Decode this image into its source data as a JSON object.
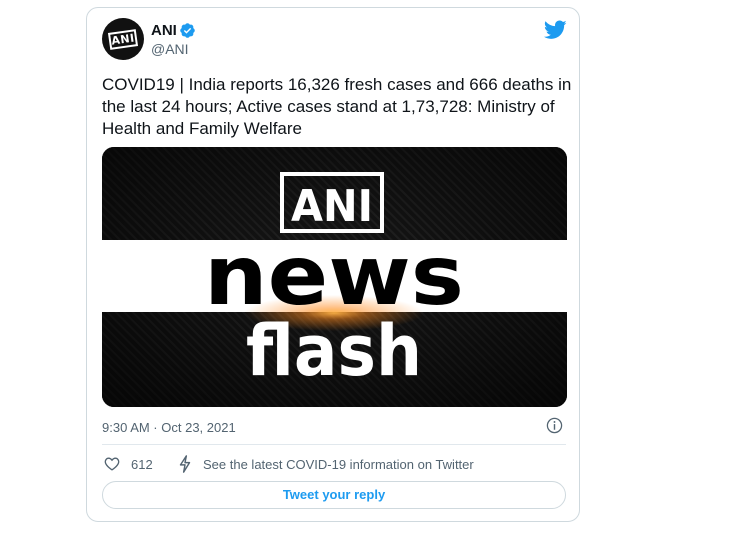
{
  "author": {
    "name": "ANI",
    "handle": "@ANI",
    "avatar_text": "ANI"
  },
  "tweet": {
    "text": "COVID19 | India reports 16,326 fresh cases and 666 deaths in the last 24 hours; Active cases stand at 1,73,728: Ministry of Health and Family Welfare",
    "media": {
      "logo_text": "ANI",
      "headline": "news",
      "subheadline": "flash"
    },
    "timestamp": "9:30 AM · Oct 23, 2021"
  },
  "actions": {
    "like_count": "612",
    "covid_info_link": "See the latest COVID-19 information on Twitter",
    "reply_button": "Tweet your reply"
  },
  "colors": {
    "twitter_blue": "#1d9bf0",
    "secondary_text": "#536471",
    "border": "#cfd9de"
  }
}
